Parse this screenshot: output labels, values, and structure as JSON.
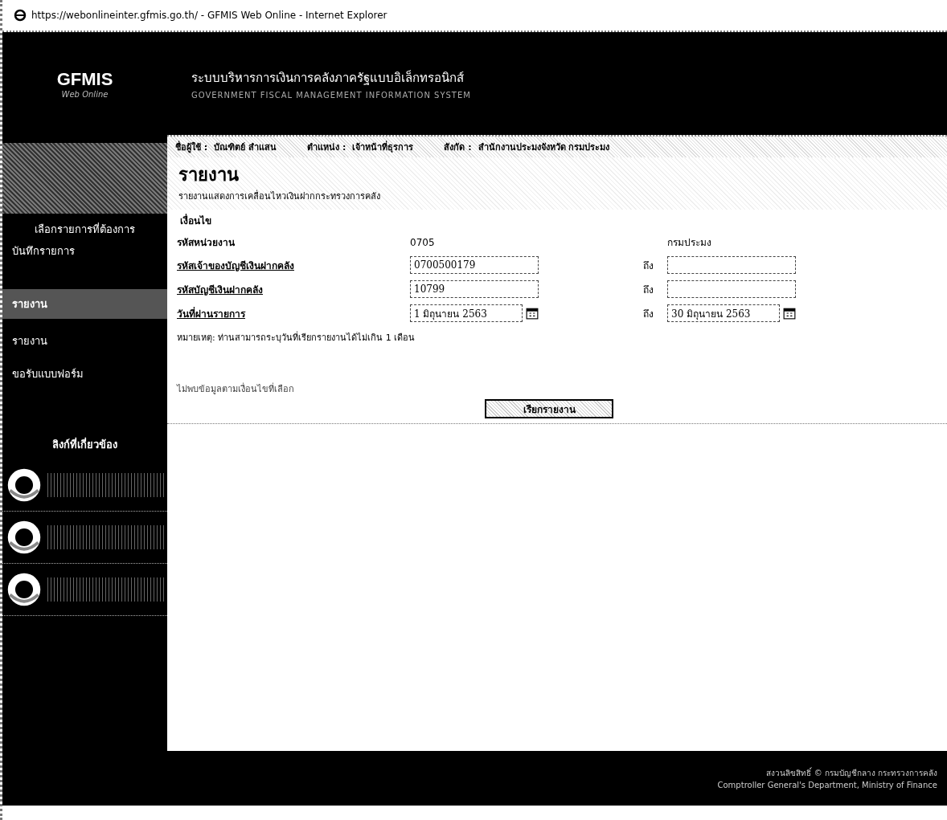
{
  "window": {
    "title": "https://webonlineinter.gfmis.go.th/ - GFMIS Web Online - Internet Explorer"
  },
  "header": {
    "logo": "GFMIS",
    "logo_subtitle": "Web Online",
    "title": "ระบบบริหารการเงินการคลังภาครัฐแบบอิเล็กทรอนิกส์",
    "subtitle": "GOVERNMENT FISCAL MANAGEMENT INFORMATION SYSTEM"
  },
  "user_bar": [
    {
      "label": "ชื่อผู้ใช้ :",
      "value": "บัณฑิตย์ สำแสน"
    },
    {
      "label": "ตำแหน่ง :",
      "value": "เจ้าหน้าที่ธุรการ"
    },
    {
      "label": "สังกัด :",
      "value": "สำนักงานประมงจังหวัด กรมประมง"
    }
  ],
  "sidebar": {
    "menu_items": [
      {
        "kind": "heading",
        "label": "เลือกรายการที่ต้องการ",
        "selected": false
      },
      {
        "kind": "item",
        "label": "บันทึกรายการ",
        "selected": false
      },
      {
        "kind": "item",
        "label": "รายงาน",
        "selected": true
      },
      {
        "kind": "item",
        "label": "รายงาน",
        "selected": false
      },
      {
        "kind": "item",
        "label": "ขอรับแบบฟอร์ม",
        "selected": false
      }
    ],
    "links_title": "ลิงก์ที่เกี่ยวข้อง"
  },
  "report": {
    "title": "รายงาน",
    "description": "รายงานแสดงการเคลื่อนไหวเงินฝากกระทรวงการคลัง",
    "section": "เงื่อนไข",
    "fields": [
      {
        "kind": "text",
        "label": "รหัสหน่วยงาน",
        "value": "0705",
        "extra": "กรมประมง"
      },
      {
        "kind": "input",
        "label": "รหัสเจ้าของบัญชีเงินฝากคลัง",
        "value": "0700500179",
        "to_label": "ถึง"
      },
      {
        "kind": "input",
        "label": "รหัสบัญชีเงินฝากคลัง",
        "value": "10799",
        "to_label": "ถึง"
      },
      {
        "kind": "date",
        "label": "วันที่ผ่านรายการ",
        "value": "1 มิถุนายน 2563",
        "to_label": "ถึง",
        "to_value": "30 มิถุนายน 2563"
      }
    ],
    "note": "หมายเหตุ: ท่านสามารถระบุวันที่เรียกรายงานได้ไม่เกิน 1 เดือน",
    "message": "ไม่พบข้อมูลตามเงื่อนไขที่เลือก",
    "button": "เรียกรายงาน"
  },
  "footer": [
    "สงวนลิขสิทธิ์ © กรมบัญชีกลาง กระทรวงการคลัง",
    "Comptroller General's Department, Ministry of Finance"
  ]
}
